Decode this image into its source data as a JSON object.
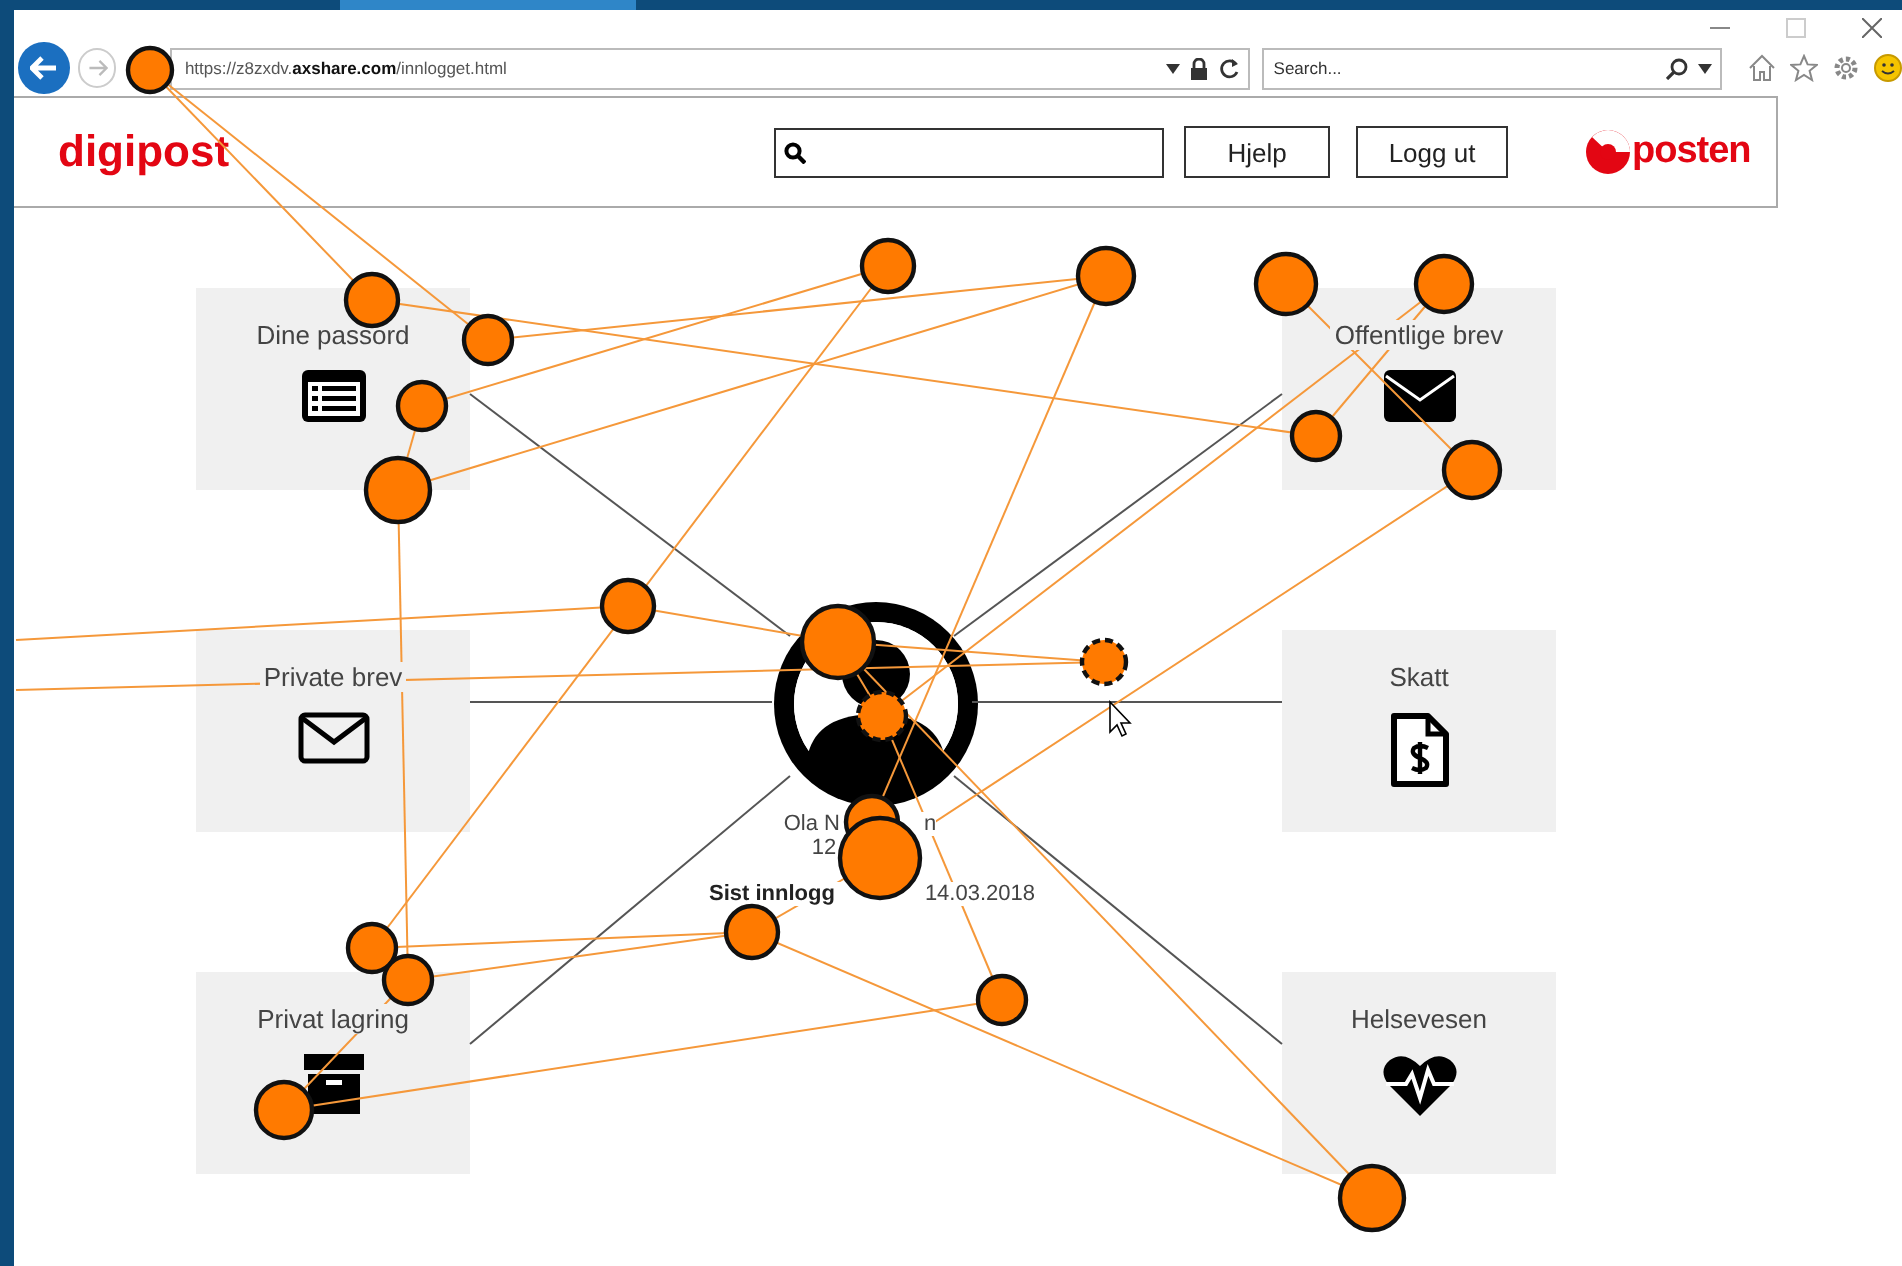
{
  "browser": {
    "address": "https://z8zxdv.**axshare.com**/innlogget.html",
    "search_placeholder": "Search..."
  },
  "header": {
    "logo": "digipost",
    "buttons": [
      "Hjelp",
      "Logg ut"
    ],
    "brand": "posten"
  },
  "left_tiles": [
    {
      "label": "Dine passord",
      "kind": "list"
    },
    {
      "label": "Private brev",
      "kind": "letter"
    },
    {
      "label": "Privat lagring",
      "kind": "storage"
    }
  ],
  "right_tiles": [
    {
      "label": "Offentlige brev",
      "kind": "mail"
    },
    {
      "label": "Skatt",
      "kind": "tax"
    },
    {
      "label": "Helsevesen",
      "kind": "health"
    }
  ],
  "profile": {
    "name_parts": [
      "Ola N",
      "n"
    ],
    "number": "12",
    "last_login_label": "Sist innlogg",
    "last_login_date": "14.03.2018"
  }
}
